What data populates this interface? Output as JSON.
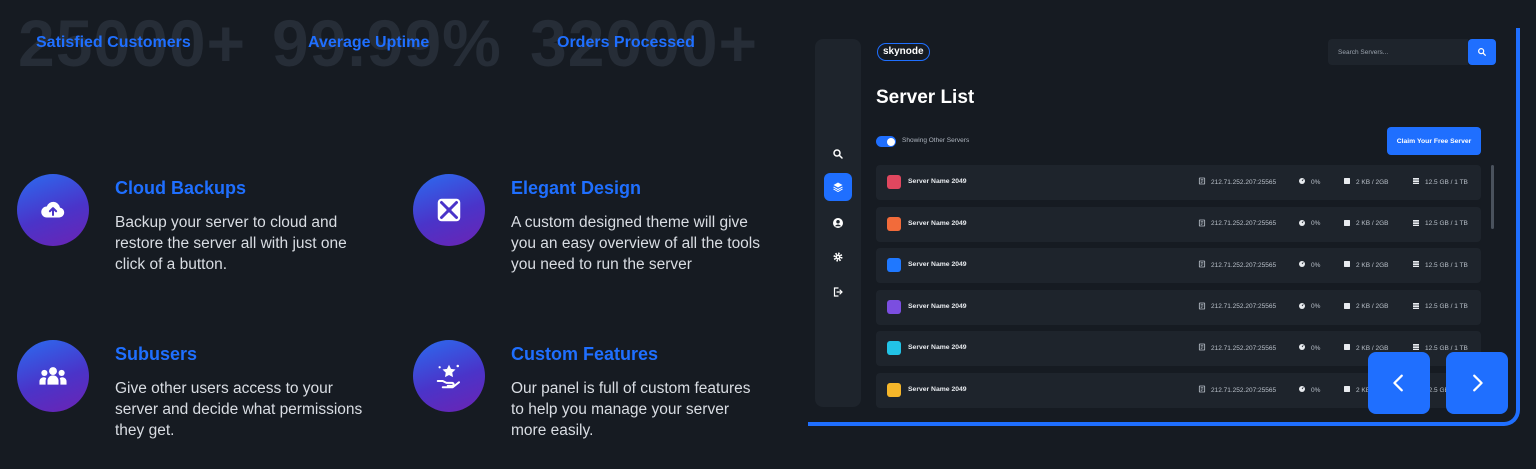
{
  "stats": [
    {
      "value": "25000+",
      "label": "Satisfied Customers"
    },
    {
      "value": "99.99%",
      "label": "Average Uptime"
    },
    {
      "value": "32000+",
      "label": "Orders Processed"
    }
  ],
  "features": [
    {
      "title": "Cloud Backups",
      "description": "Backup your server to cloud and restore the server all with just one click of a button.",
      "icon": "cloud-upload-icon"
    },
    {
      "title": "Elegant Design",
      "description": "A custom designed theme will give you an easy overview of all the tools you need to run the server",
      "icon": "design-tools-icon"
    },
    {
      "title": "Subusers",
      "description": "Give other users access to your server and decide what permissions they get.",
      "icon": "users-group-icon"
    },
    {
      "title": "Custom Features",
      "description": "Our panel is full of custom features to help you manage your server more easily.",
      "icon": "star-hand-icon"
    }
  ],
  "panel": {
    "logo": "skynode",
    "search": {
      "placeholder": "Search Servers..."
    },
    "title": "Server List",
    "toggle_label": "Showing Other Servers",
    "claim_label": "Claim Your Free Server",
    "servers": [
      {
        "name": "Server Name 2049",
        "color": "#e0475f",
        "ip": "212.71.252.207:25565",
        "cpu": "0%",
        "ram": "2 KB / 2GB",
        "disk": "12.5 GB / 1 TB"
      },
      {
        "name": "Server Name 2049",
        "color": "#f26b3a",
        "ip": "212.71.252.207:25565",
        "cpu": "0%",
        "ram": "2 KB / 2GB",
        "disk": "12.5 GB / 1 TB"
      },
      {
        "name": "Server Name 2049",
        "color": "#1f78ff",
        "ip": "212.71.252.207:25565",
        "cpu": "0%",
        "ram": "2 KB / 2GB",
        "disk": "12.5 GB / 1 TB"
      },
      {
        "name": "Server Name 2049",
        "color": "#7b4ee0",
        "ip": "212.71.252.207:25565",
        "cpu": "0%",
        "ram": "2 KB / 2GB",
        "disk": "12.5 GB / 1 TB"
      },
      {
        "name": "Server Name 2049",
        "color": "#22c3e6",
        "ip": "212.71.252.207:25565",
        "cpu": "0%",
        "ram": "2 KB / 2GB",
        "disk": "12.5 GB / 1 TB"
      },
      {
        "name": "Server Name 2049",
        "color": "#f5b62a",
        "ip": "212.71.252.207:25565",
        "cpu": "0%",
        "ram": "2 KB / 2GB",
        "disk": "12.5 GB / 1 TB"
      }
    ]
  },
  "colors": {
    "accent": "#1f6fff",
    "background": "#161b22",
    "card": "#1e242c"
  }
}
